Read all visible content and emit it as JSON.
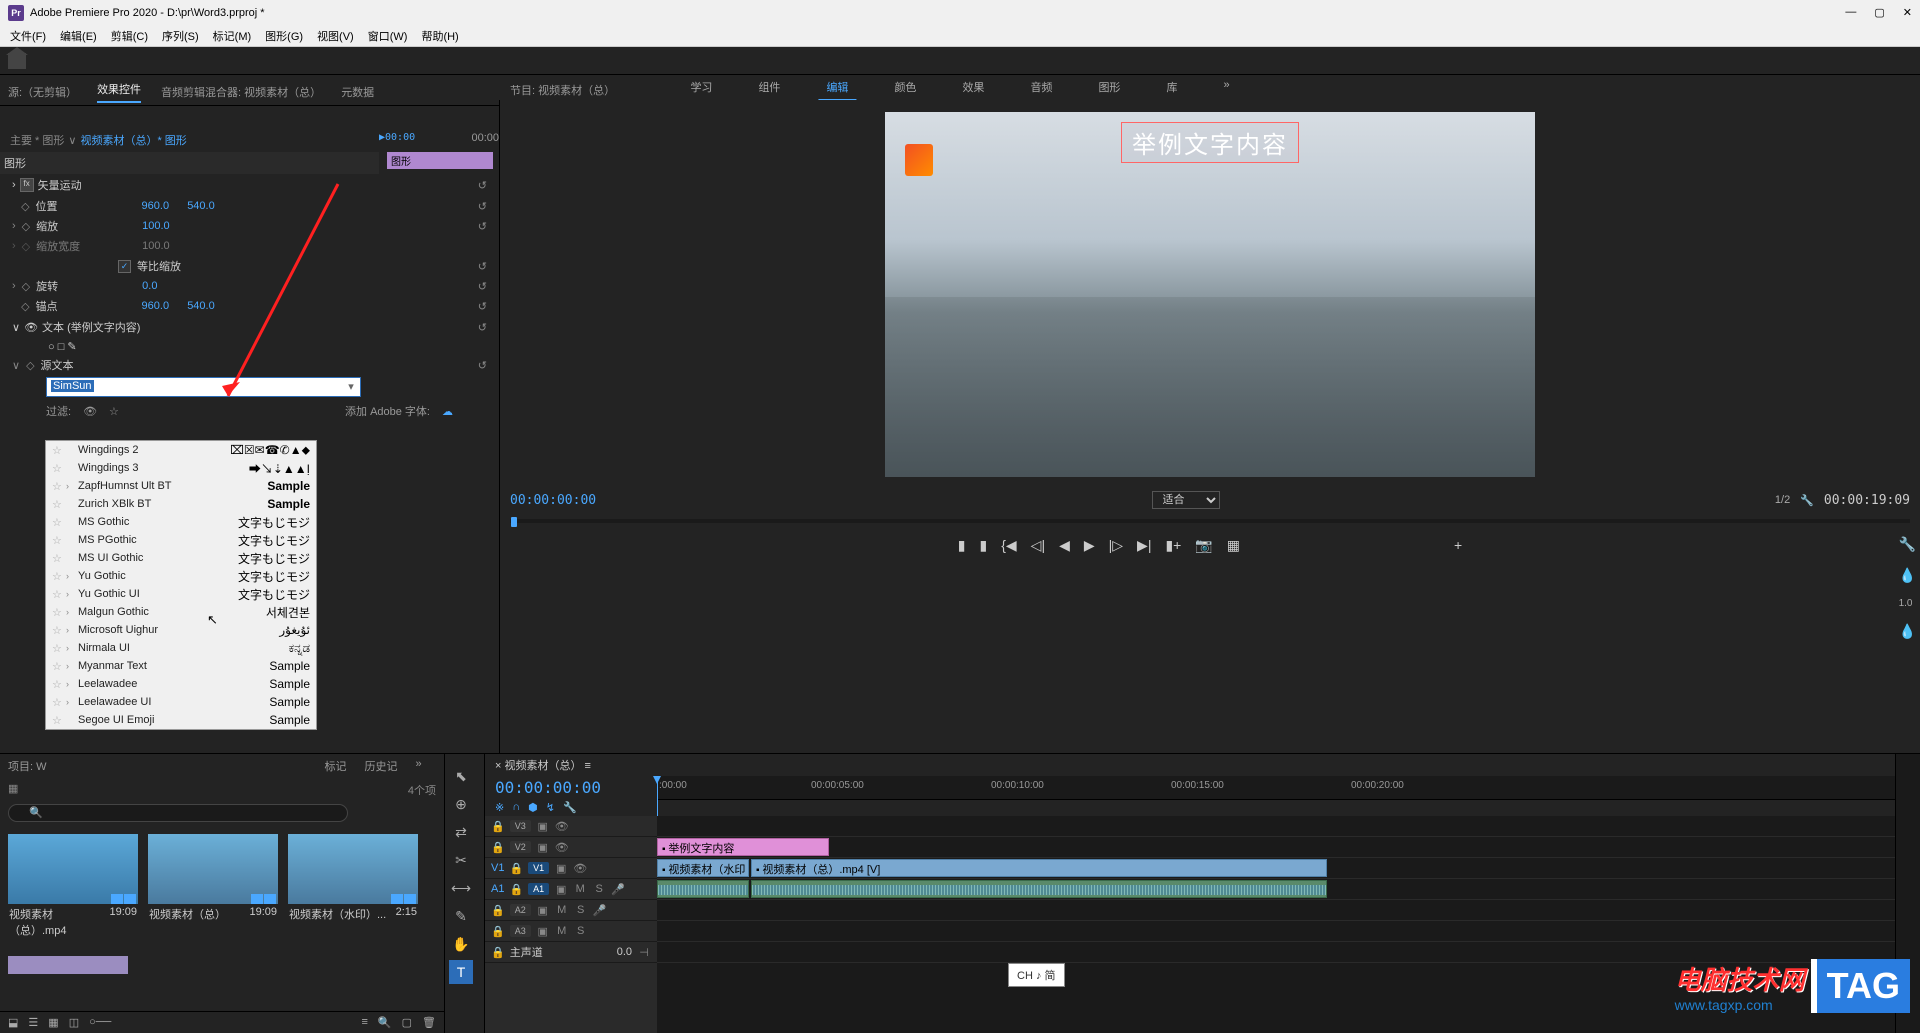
{
  "app": {
    "title": "Adobe Premiere Pro 2020 - D:\\pr\\Word3.prproj *",
    "pr_logo": "Pr"
  },
  "menu": [
    "文件(F)",
    "编辑(E)",
    "剪辑(C)",
    "序列(S)",
    "标记(M)",
    "图形(G)",
    "视图(V)",
    "窗口(W)",
    "帮助(H)"
  ],
  "workspace_tabs": [
    "学习",
    "组件",
    "编辑",
    "颜色",
    "效果",
    "音频",
    "图形",
    "库"
  ],
  "workspace_active": "编辑",
  "source_tabs": [
    "源:（无剪辑）",
    "效果控件",
    "音频剪辑混合器: 视频素材（总）",
    "元数据"
  ],
  "source_active": "效果控件",
  "effect_header": {
    "left": "主要 * 图形",
    "bridge": "∨",
    "right": "视频素材（总）* 图形",
    "start": "▶00:00",
    "end": "00:00"
  },
  "mini_clip": "图形",
  "sections": {
    "section1": "图形",
    "vector": "矢量运动",
    "position": "位置",
    "pos_x": "960.0",
    "pos_y": "540.0",
    "scale": "缩放",
    "scale_v": "100.0",
    "scale_w": "缩放宽度",
    "scale_wv": "100.0",
    "equal": "等比缩放",
    "rotation": "旋转",
    "rot_v": "0.0",
    "anchor": "锚点",
    "anc_x": "960.0",
    "anc_y": "540.0",
    "text_section": "文本 (举例文字内容)",
    "shapes": "○ □ ✎",
    "sourcetext": "源文本"
  },
  "font_input": "SimSun",
  "filter_label": "过滤:",
  "add_font_label": "添加 Adobe 字体:",
  "font_dropdown": [
    {
      "name": "Wingdings 2",
      "preview": "⌧☒✉☎✆▲⬥",
      "chev": ""
    },
    {
      "name": "Wingdings 3",
      "preview": "⮕↘⇣▲▲Ị",
      "chev": ""
    },
    {
      "name": "ZapfHumnst Ult BT",
      "preview": "Sample",
      "bold": true,
      "chev": "›"
    },
    {
      "name": "Zurich XBlk BT",
      "preview": "Sample",
      "bold": true,
      "chev": ""
    },
    {
      "name": "MS Gothic",
      "preview": "文字もじモジ",
      "chev": ""
    },
    {
      "name": "MS PGothic",
      "preview": "文字もじモジ",
      "chev": ""
    },
    {
      "name": "MS UI Gothic",
      "preview": "文字もじモジ",
      "chev": ""
    },
    {
      "name": "Yu Gothic",
      "preview": "文字もじモジ",
      "chev": "›"
    },
    {
      "name": "Yu Gothic UI",
      "preview": "文字もじモジ",
      "chev": "›"
    },
    {
      "name": "Malgun Gothic",
      "preview": "서체견본",
      "chev": "›"
    },
    {
      "name": "Microsoft Uighur",
      "preview": "ئۇيغۇر",
      "chev": "›"
    },
    {
      "name": "Nirmala UI",
      "preview": "ಕನ್ನಡ",
      "chev": "›"
    },
    {
      "name": "Myanmar Text",
      "preview": "Sample",
      "chev": "›"
    },
    {
      "name": "Leelawadee",
      "preview": "Sample",
      "chev": "›"
    },
    {
      "name": "Leelawadee UI",
      "preview": "Sample",
      "chev": "›"
    },
    {
      "name": "Segoe UI Emoji",
      "preview": "Sample",
      "chev": ""
    }
  ],
  "program": {
    "title": "节目: 视频素材（总）",
    "text_overlay": "举例文字内容",
    "timecode": "00:00:00:00",
    "zoom": "适合",
    "ratio": "1/2",
    "duration": "00:00:19:09"
  },
  "project": {
    "tab1": "项目: W",
    "tab2": "标记",
    "tab3": "历史记",
    "info": "4个项",
    "items": [
      {
        "name": "视频素材（总）.mp4",
        "dur": "19:09"
      },
      {
        "name": "视频素材（总）",
        "dur": "19:09"
      },
      {
        "name": "视频素材（水印）...",
        "dur": "2:15"
      }
    ]
  },
  "tools": [
    "⬉",
    "⊕",
    "✂",
    "✎",
    "▭",
    "✋",
    "T"
  ],
  "timeline": {
    "title": "视频素材（总）",
    "timecode": "00:00:00:00",
    "ruler": [
      ":00:00",
      "00:00:05:00",
      "00:00:10:00",
      "00:00:15:00",
      "00:00:20:00"
    ],
    "tracks": {
      "v3": "V3",
      "v2": "V2",
      "v1": "V1",
      "a1": "A1",
      "a2": "A2",
      "a3": "A3",
      "master": "主声道",
      "master_v": "0.0"
    },
    "clip_text": "举例文字内容",
    "clip_video1": "视频素材（水印",
    "clip_video2": "视频素材（总）.mp4 [V]"
  },
  "ch_popup": "CH ♪ 简",
  "watermark": {
    "text": "电脑技术网",
    "url": "www.tagxp.com",
    "tag": "TAG"
  }
}
